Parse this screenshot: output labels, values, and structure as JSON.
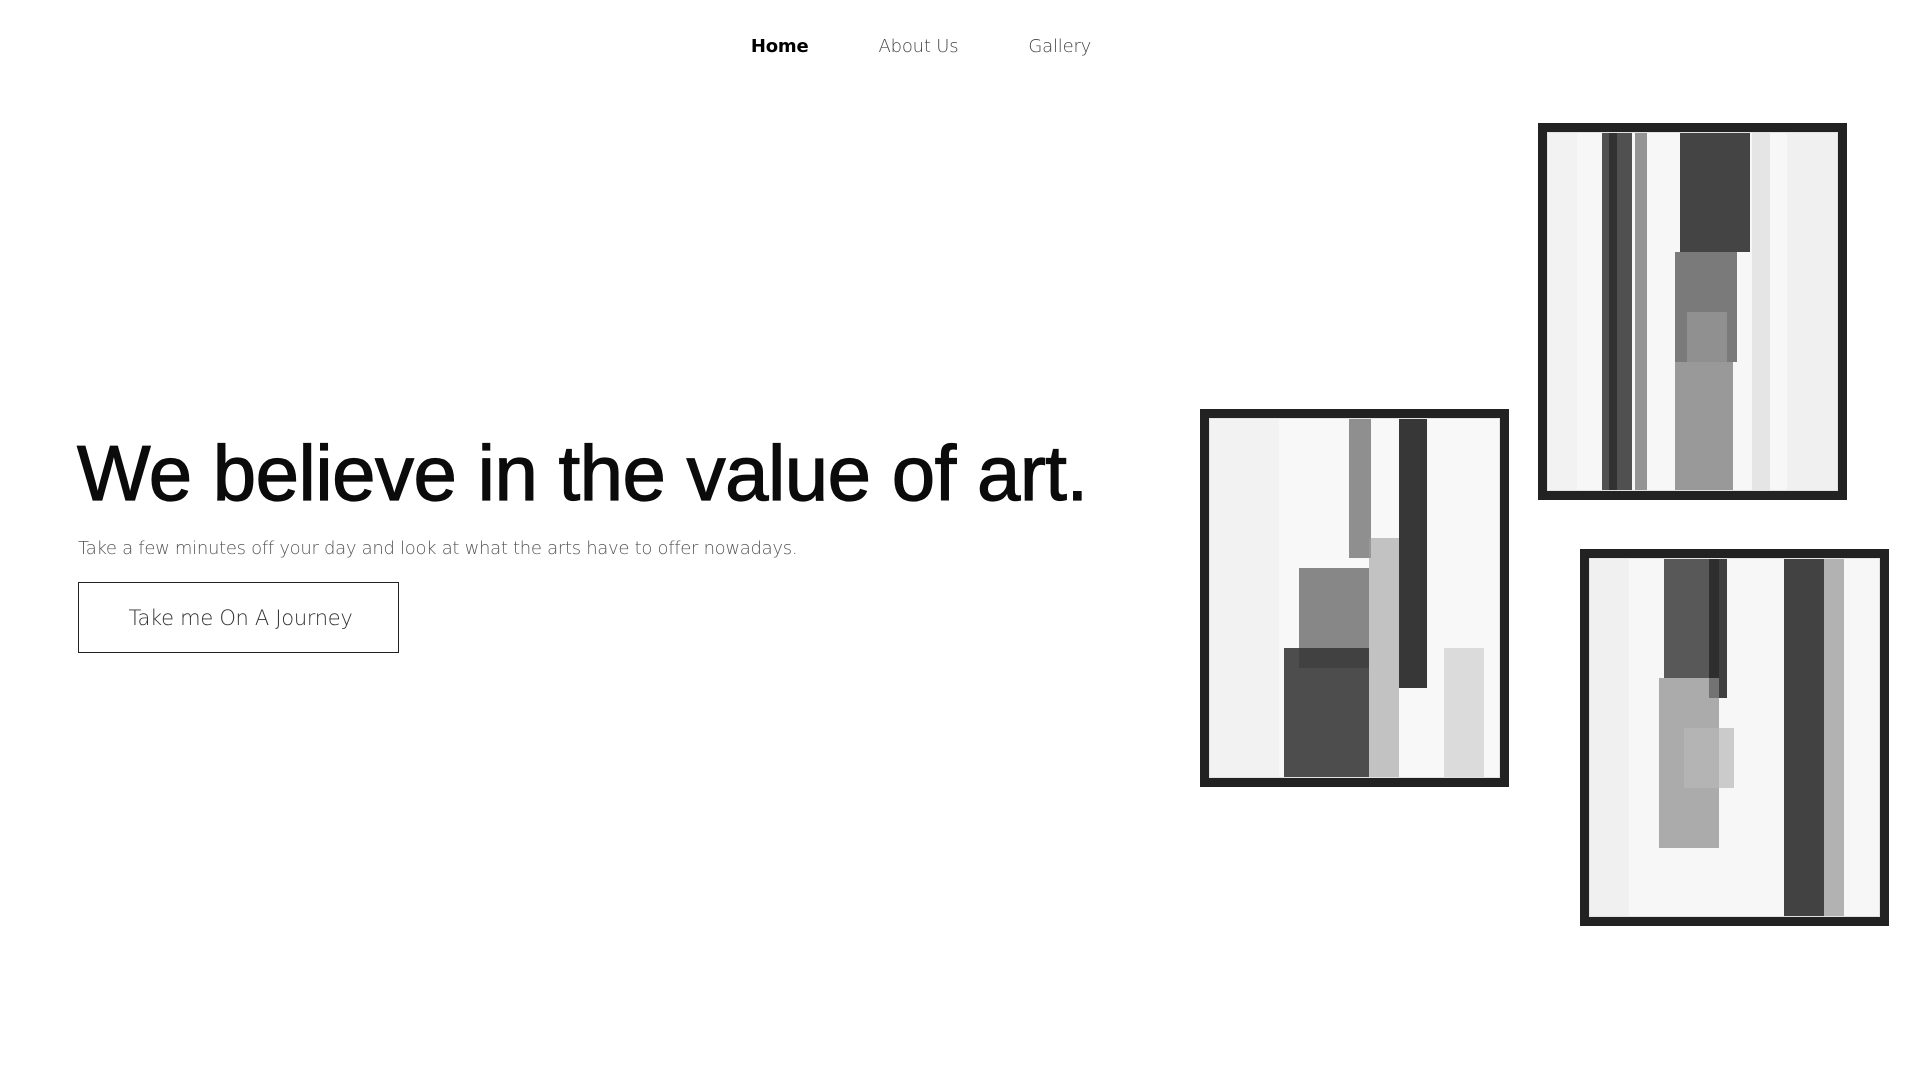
{
  "nav": {
    "items": [
      {
        "label": "Home",
        "active": true
      },
      {
        "label": "About Us",
        "active": false
      },
      {
        "label": "Gallery",
        "active": false
      }
    ]
  },
  "hero": {
    "title": "We believe in the value of art.",
    "subtitle": "Take a few minutes off your day and look at what the arts have to offer nowadays.",
    "cta_label": "Take me On A Journey"
  },
  "artworks": [
    {
      "name": "framed-abstract-print-1",
      "frame_color": "#222222"
    },
    {
      "name": "framed-abstract-print-2",
      "frame_color": "#222222"
    },
    {
      "name": "framed-abstract-print-3",
      "frame_color": "#222222"
    }
  ],
  "colors": {
    "background": "#ffffff",
    "text_primary": "#0b0b0b",
    "text_secondary": "#555555",
    "frame": "#222222"
  }
}
